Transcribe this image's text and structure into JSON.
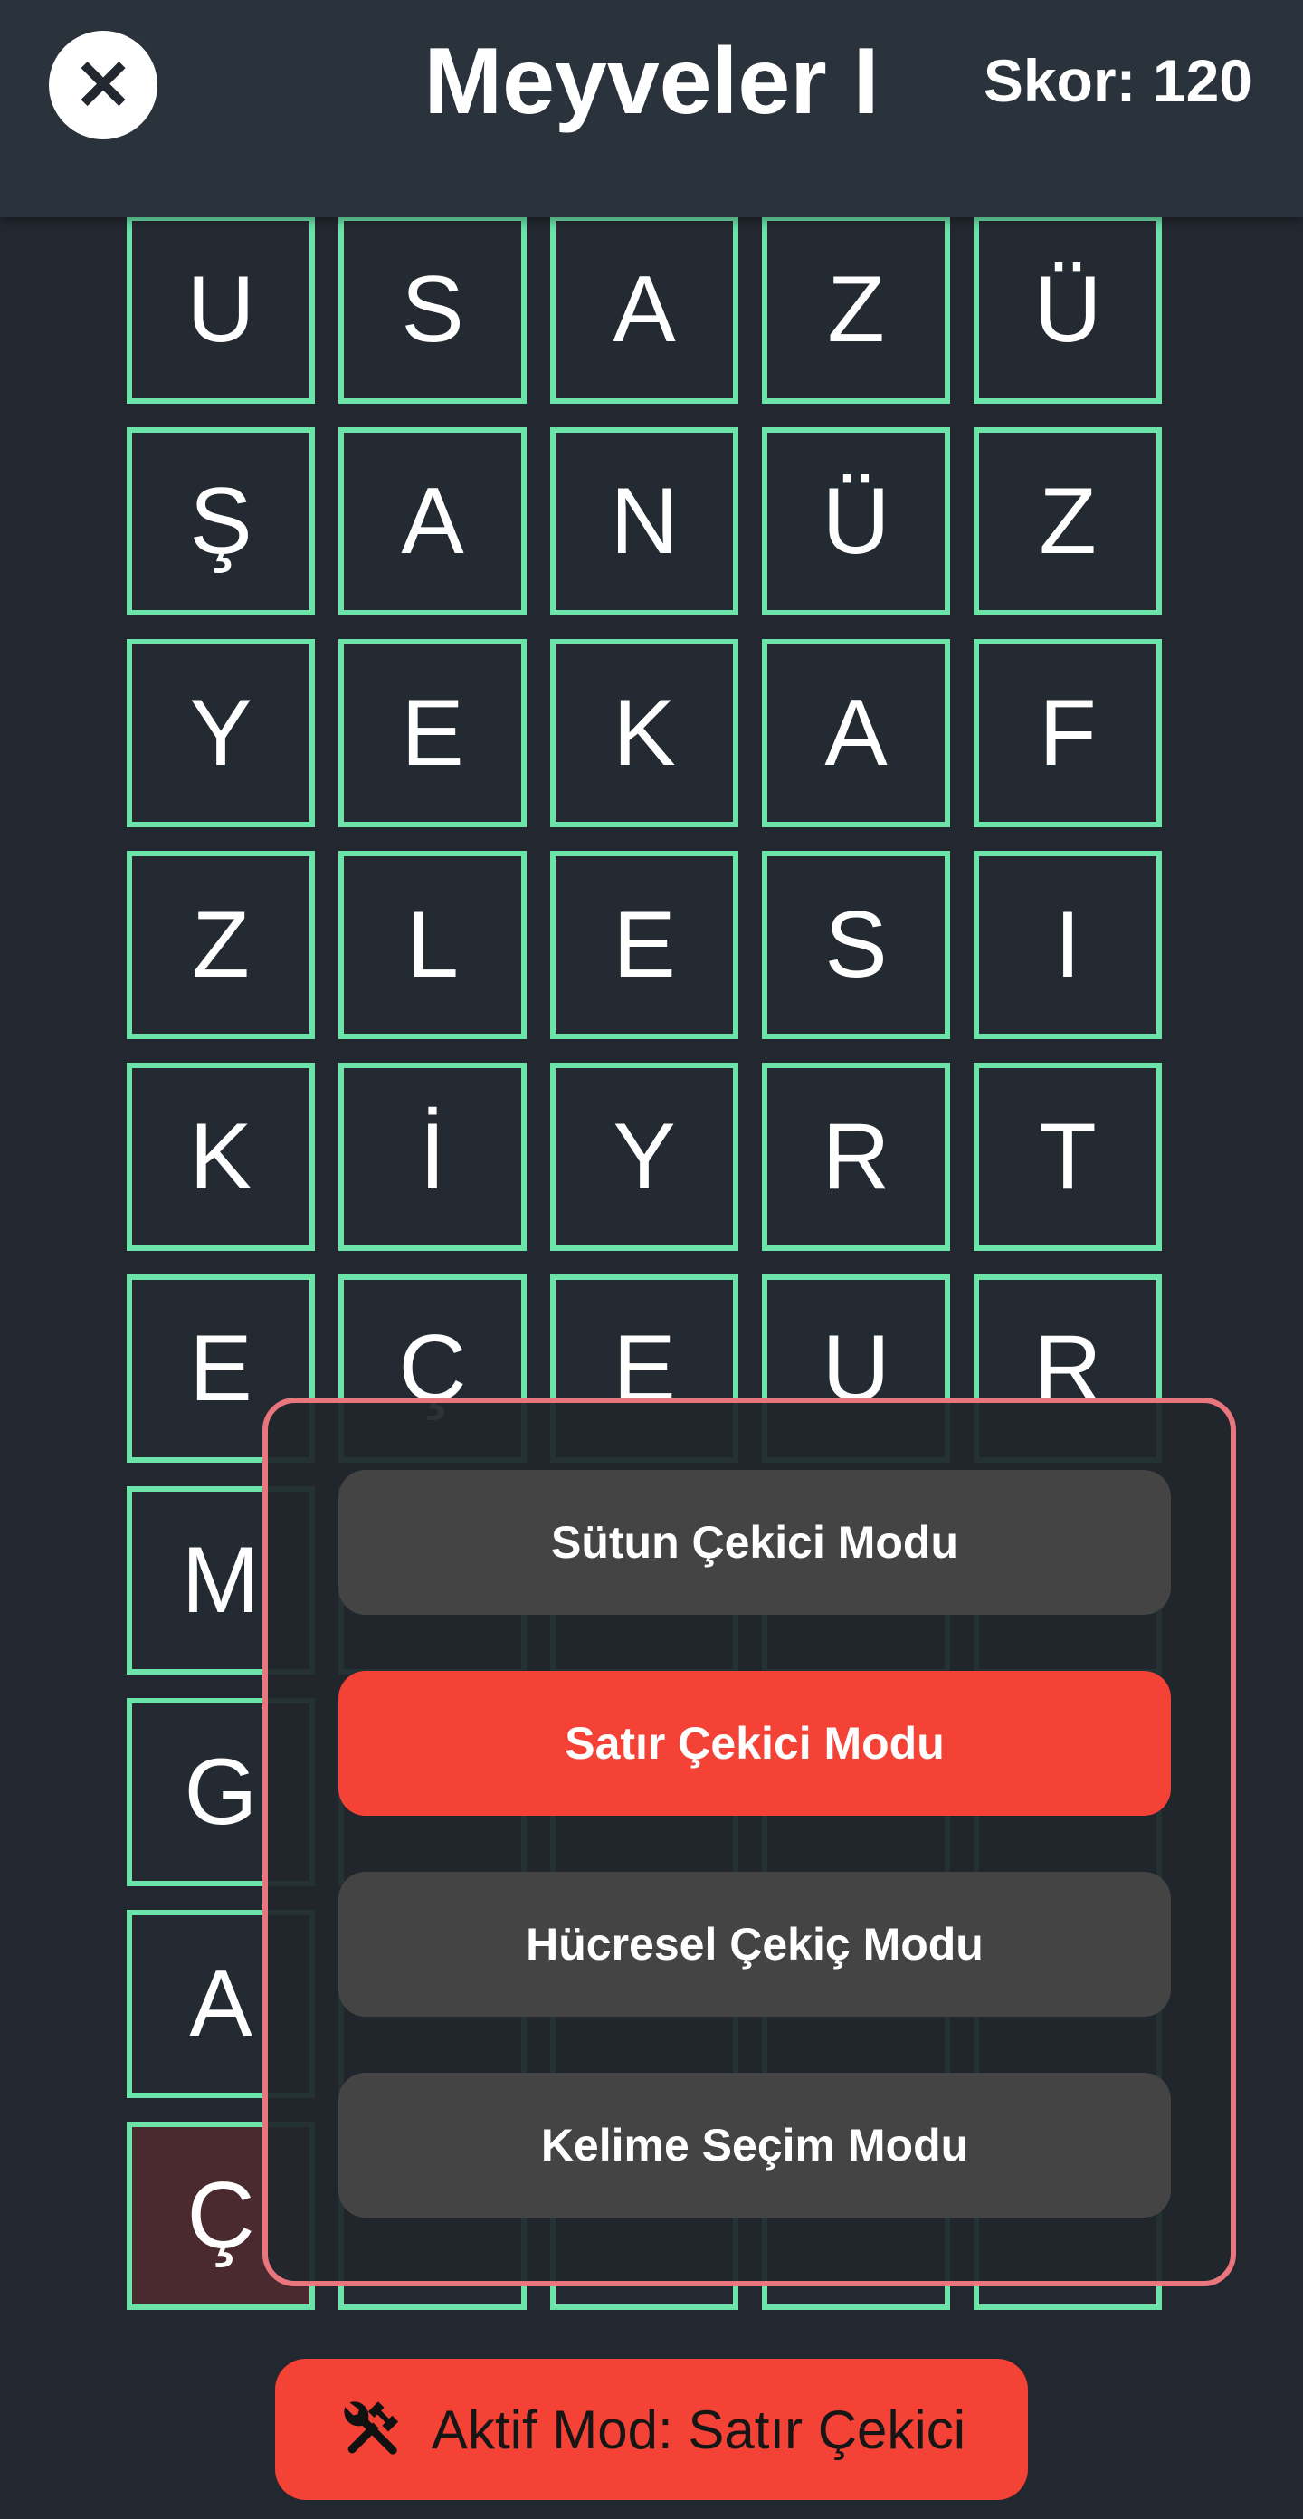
{
  "header": {
    "close_icon": "close-icon",
    "title": "Meyveler I",
    "score": "Skor: 120"
  },
  "colors": {
    "background": "#232830",
    "header": "#2a333b",
    "cell_border": "#6be3a9",
    "marked_cell": "#4a2a2e",
    "active": "#f44336",
    "inactive_button": "#444444",
    "modal_border": "#e9767c"
  },
  "grid": {
    "rows": [
      [
        "U",
        "S",
        "A",
        "Z",
        "Ü"
      ],
      [
        "Ş",
        "A",
        "N",
        "Ü",
        "Z"
      ],
      [
        "Y",
        "E",
        "K",
        "A",
        "F"
      ],
      [
        "Z",
        "L",
        "E",
        "S",
        "I"
      ],
      [
        "K",
        "İ",
        "Y",
        "R",
        "T"
      ],
      [
        "E",
        "Ç",
        "E",
        "U",
        "R"
      ],
      [
        "M",
        "",
        "",
        "",
        ""
      ],
      [
        "G",
        "",
        "",
        "",
        ""
      ],
      [
        "A",
        "",
        "",
        "",
        ""
      ],
      [
        "Ç",
        "",
        "",
        "",
        ""
      ]
    ],
    "marked_cells": [
      [
        9,
        0
      ]
    ]
  },
  "mode_menu": {
    "options": [
      {
        "label": "Sütun Çekici Modu",
        "active": false
      },
      {
        "label": "Satır Çekici Modu",
        "active": true
      },
      {
        "label": "Hücresel Çekiç Modu",
        "active": false
      },
      {
        "label": "Kelime Seçim Modu",
        "active": false
      }
    ]
  },
  "active_mode": {
    "icon": "hammer-wrench-icon",
    "label": "Aktif Mod: Satır Çekici"
  }
}
